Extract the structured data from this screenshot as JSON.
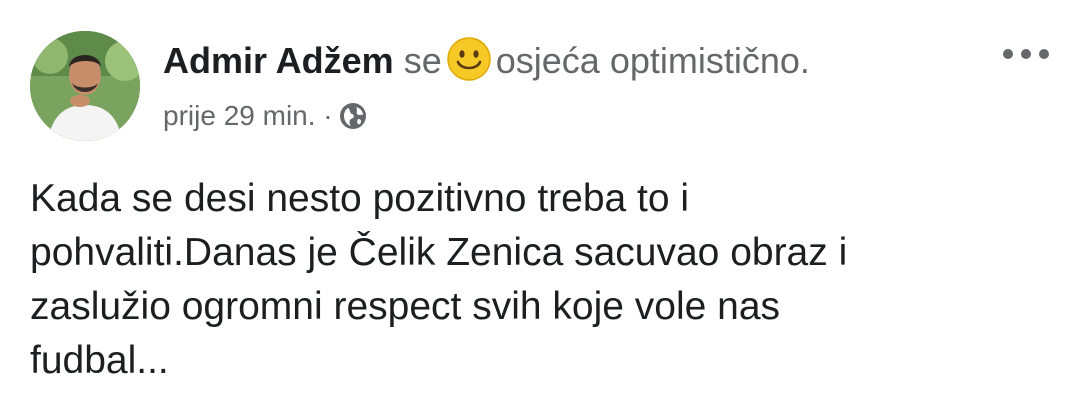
{
  "post": {
    "author_name": "Admir Adžem",
    "feeling_prefix": "se",
    "feeling_emoji": "smiling-face-icon",
    "feeling_text": "osjeća optimistično.",
    "timestamp": "prije 29 min.",
    "separator": "·",
    "privacy_icon": "globe-icon",
    "body_lines": [
      "Kada se desi nesto pozitivno treba to i",
      "pohvaliti.Danas je Čelik Zenica sacuvao obraz i",
      "zaslužio ogromni respect svih koje vole nas",
      "fudbal..."
    ]
  },
  "colors": {
    "primary_text": "#1c1e21",
    "secondary_text": "#65676b",
    "emoji_yellow": "#f7c926"
  }
}
